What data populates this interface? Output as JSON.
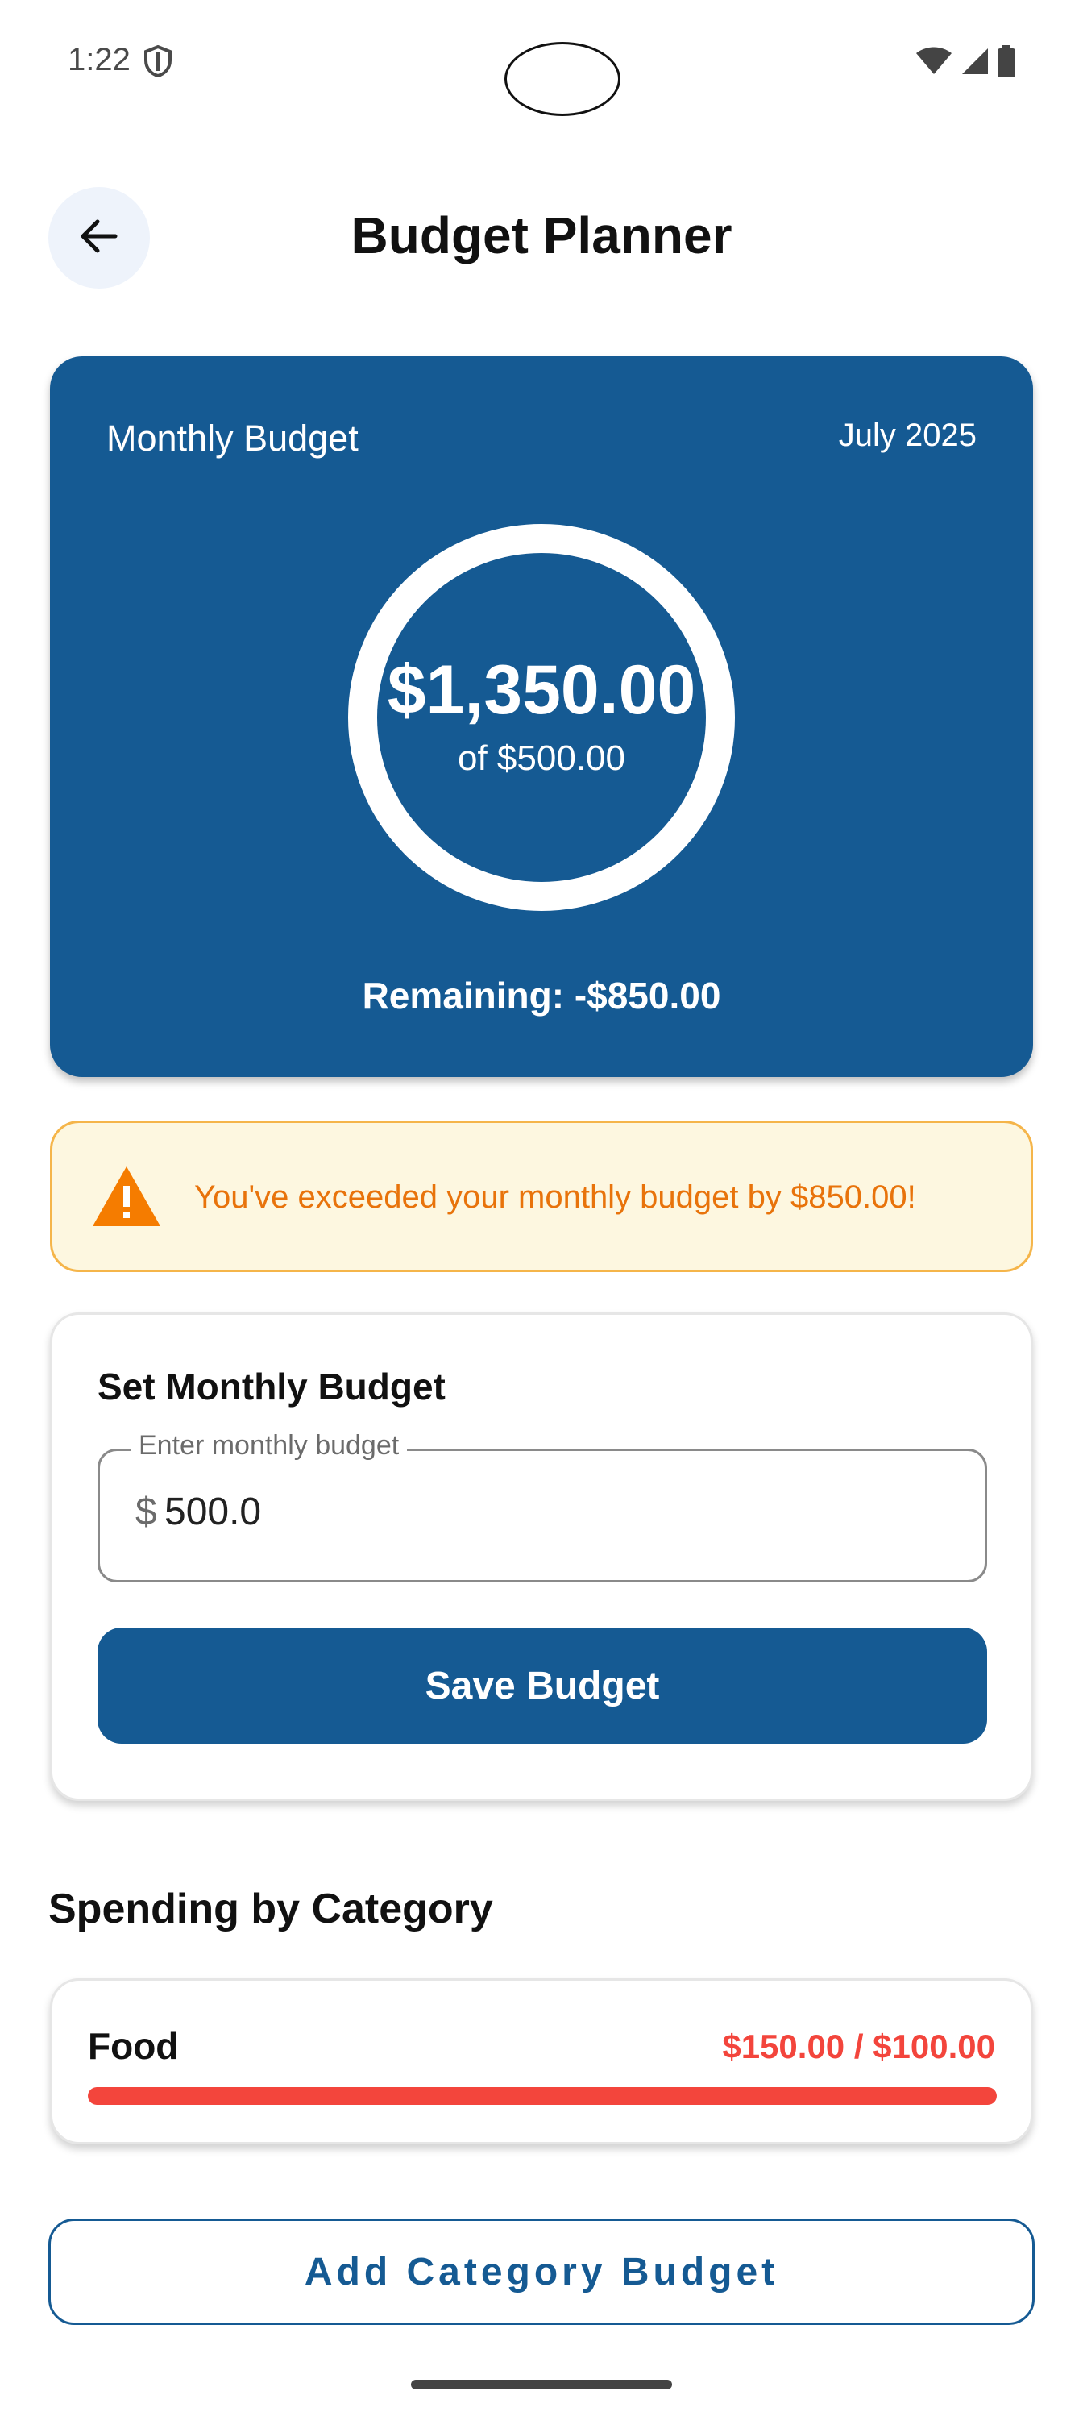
{
  "status_bar": {
    "time": "1:22"
  },
  "header": {
    "title": "Budget Planner"
  },
  "budget_card": {
    "label": "Monthly Budget",
    "month": "July 2025",
    "spent": "$1,350.00",
    "of_total": "of $500.00",
    "remaining": "Remaining: -$850.00",
    "accent_color": "#155a93"
  },
  "warning": {
    "message": "You've exceeded your monthly budget by $850.00!",
    "color": "#e8730b"
  },
  "set_budget": {
    "title": "Set Monthly Budget",
    "field_label": "Enter monthly budget",
    "currency_prefix": "$",
    "value": "500.0",
    "save_label": "Save Budget"
  },
  "categories": {
    "title": "Spending by Category",
    "items": [
      {
        "name": "Food",
        "amount": "$150.00 / $100.00",
        "progress": 1.0,
        "color": "#f3453c"
      }
    ],
    "add_label": "Add Category Budget"
  }
}
